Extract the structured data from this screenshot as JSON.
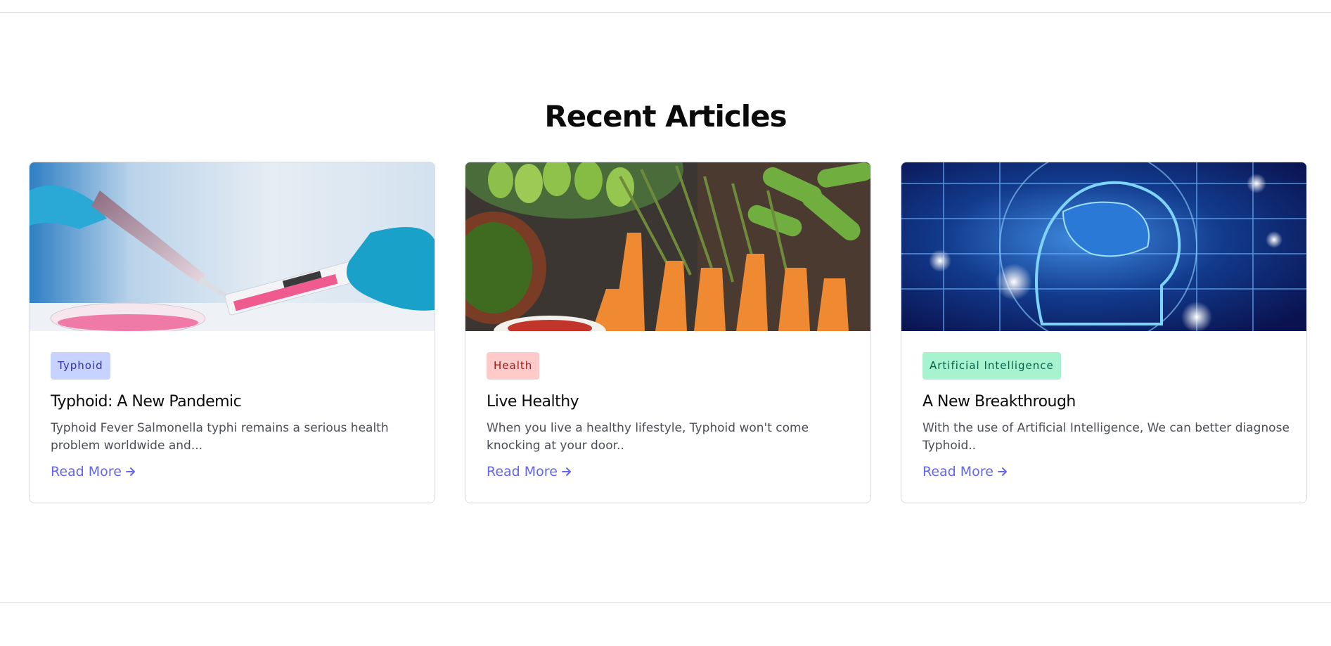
{
  "section": {
    "title": "Recent Articles"
  },
  "articles": [
    {
      "tag": "Typhoid",
      "tag_bg": "#c7d2fe",
      "tag_color": "#3730a3",
      "title": "Typhoid: A New Pandemic",
      "excerpt": "Typhoid Fever Salmonella typhi remains a serious health problem worldwide and...",
      "link_label": "Read More",
      "image_icon": "lab-pipette-image"
    },
    {
      "tag": "Health",
      "tag_bg": "#fecaca",
      "tag_color": "#991b1b",
      "title": "Live Healthy",
      "excerpt": "When you live a healthy lifestyle, Typhoid won't come knocking at your door..",
      "link_label": "Read More",
      "image_icon": "vegetables-image"
    },
    {
      "tag": "Artificial Intelligence",
      "tag_bg": "#a7f3d0",
      "tag_color": "#065f46",
      "title": "A New Breakthrough",
      "excerpt": "With the use of Artificial Intelligence, We can better diagnose Typhoid..",
      "link_label": "Read More",
      "image_icon": "ai-brain-image"
    }
  ],
  "colors": {
    "link": "#6366f1",
    "border": "#d9dce1"
  }
}
